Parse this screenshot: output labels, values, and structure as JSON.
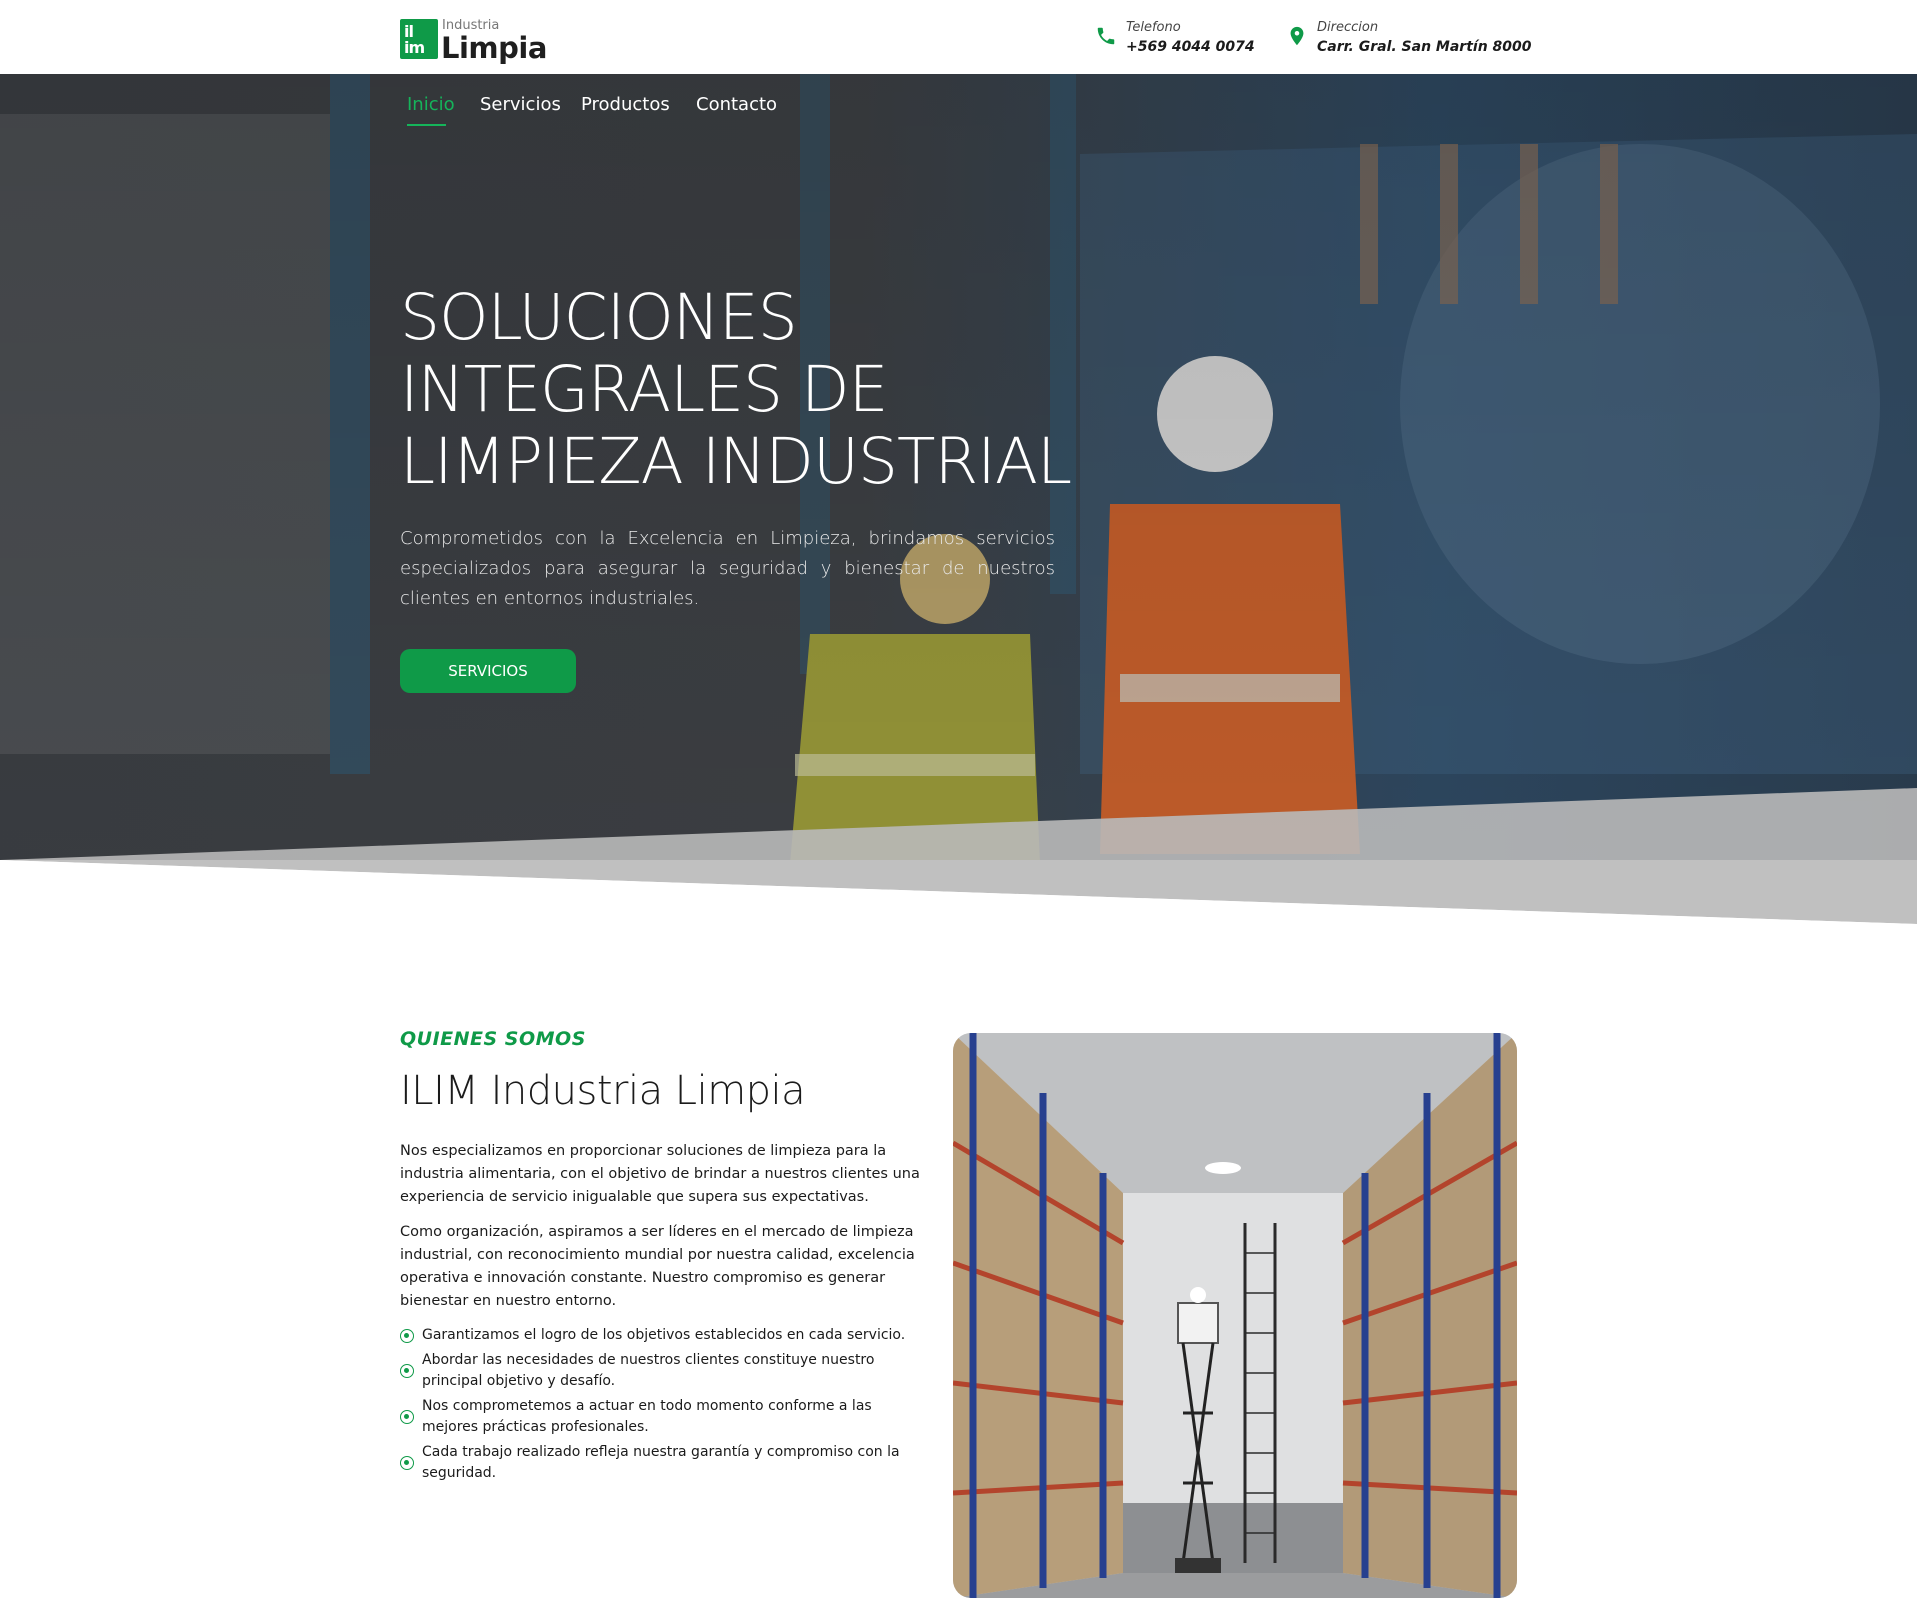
{
  "brand": {
    "mark_top": "il",
    "mark_bottom": "im",
    "small": "Industria",
    "big": "Limpia",
    "green": "#0f9a48"
  },
  "contact": {
    "phone_label": "Telefono",
    "phone_value": "+569 4044 0074",
    "address_label": "Direccion",
    "address_value": "Carr. Gral. San Martín 8000",
    "phone_icon": "phone-icon",
    "address_icon": "map-pin-icon"
  },
  "nav": {
    "items": [
      "Inicio",
      "Servicios",
      "Productos",
      "Contacto"
    ],
    "active": "Inicio"
  },
  "hero": {
    "title_lines": [
      "SOLUCIONES",
      "INTEGRALES DE",
      "LIMPIEZA INDUSTRIAL"
    ],
    "text": "Comprometidos con la Excelencia en Limpieza, brindamos servicios especializados para asegurar la seguridad y bienestar de nuestros clientes en entornos industriales.",
    "button": "SERVICIOS"
  },
  "about": {
    "eyebrow": "QUIENES SOMOS",
    "title": "ILIM Industria Limpia",
    "p1": "Nos especializamos en proporcionar soluciones de limpieza para la industria alimentaria, con el objetivo de brindar a nuestros clientes una experiencia de servicio inigualable que supera sus expectativas.",
    "p2": "Como organización, aspiramos a ser líderes en el mercado de limpieza industrial, con reconocimiento mundial por nuestra calidad, excelencia operativa e innovación constante. Nuestro compromiso es generar bienestar en nuestro entorno.",
    "checklist": [
      "Garantizamos el logro de los objetivos establecidos en cada servicio.",
      "Abordar las necesidades de nuestros clientes constituye nuestro principal objetivo y desafío.",
      "Nos comprometemos a actuar en todo momento conforme a las mejores prácticas profesionales.",
      "Cada trabajo realizado refleja nuestra garantía y compromiso con la seguridad."
    ]
  }
}
